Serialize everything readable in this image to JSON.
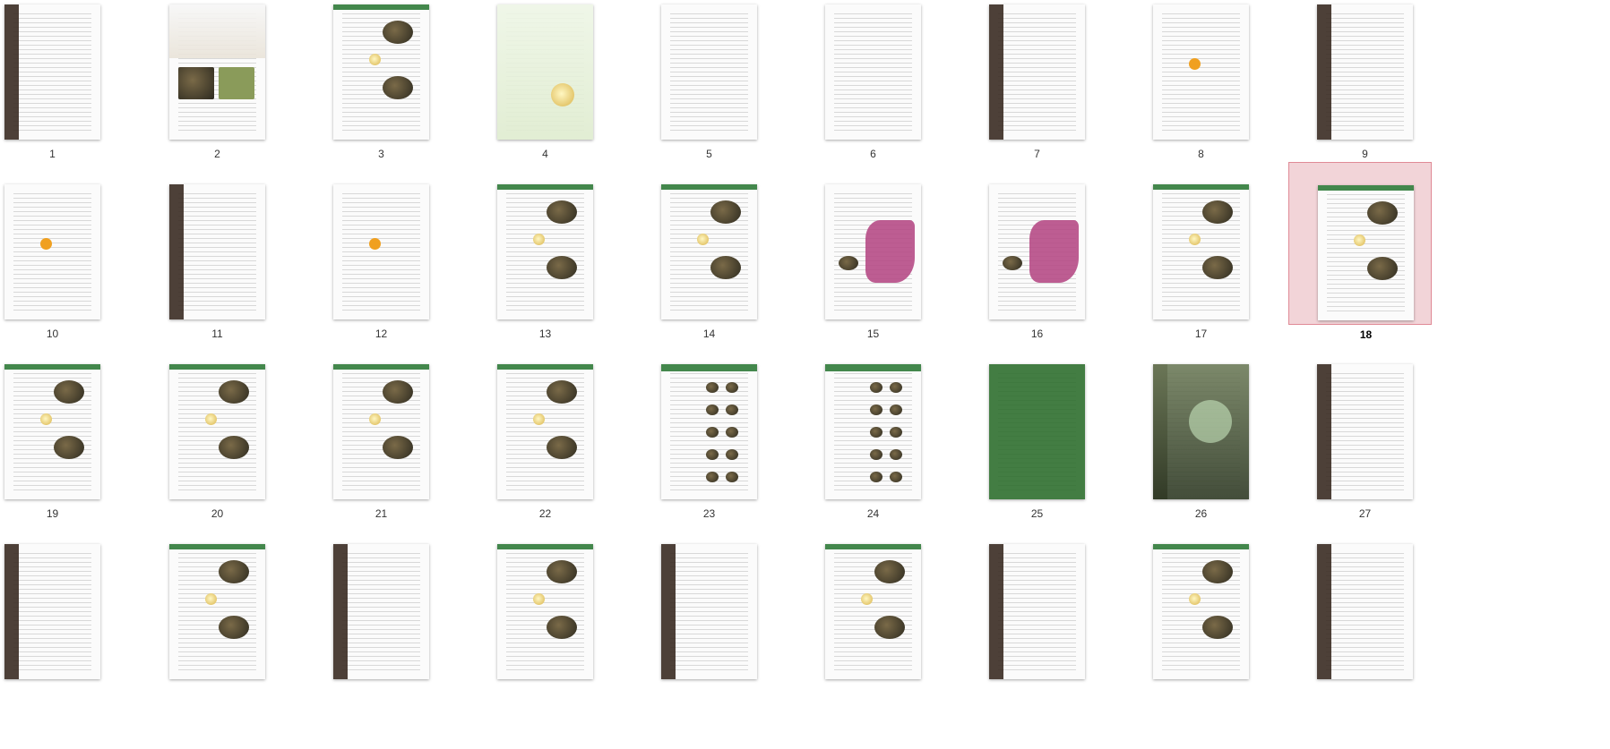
{
  "pages": [
    {
      "number": "1",
      "theme": "text-dark"
    },
    {
      "number": "2",
      "theme": "cover-collage"
    },
    {
      "number": "3",
      "theme": "text-leaves"
    },
    {
      "number": "4",
      "theme": "cover-green"
    },
    {
      "number": "5",
      "theme": "text"
    },
    {
      "number": "6",
      "theme": "text"
    },
    {
      "number": "7",
      "theme": "toc-photo"
    },
    {
      "number": "8",
      "theme": "toc"
    },
    {
      "number": "9",
      "theme": "toc-photo"
    },
    {
      "number": "10",
      "theme": "toc"
    },
    {
      "number": "11",
      "theme": "toc-photo"
    },
    {
      "number": "12",
      "theme": "toc"
    },
    {
      "number": "13",
      "theme": "tea-green"
    },
    {
      "number": "14",
      "theme": "tea-green"
    },
    {
      "number": "15",
      "theme": "map-pink"
    },
    {
      "number": "16",
      "theme": "map-pink"
    },
    {
      "number": "17",
      "theme": "tea-list"
    },
    {
      "number": "18",
      "theme": "tea-list",
      "selected": true
    },
    {
      "number": "19",
      "theme": "tea-list"
    },
    {
      "number": "20",
      "theme": "tea-list"
    },
    {
      "number": "21",
      "theme": "tea-list"
    },
    {
      "number": "22",
      "theme": "tea-list"
    },
    {
      "number": "23",
      "theme": "table-green"
    },
    {
      "number": "24",
      "theme": "table-green"
    },
    {
      "number": "25",
      "theme": "full-green"
    },
    {
      "number": "26",
      "theme": "photo-circle"
    },
    {
      "number": "27",
      "theme": "text-photo"
    },
    {
      "number": "",
      "theme": "text-photo"
    },
    {
      "number": "",
      "theme": "tea-list"
    },
    {
      "number": "",
      "theme": "text-photo"
    },
    {
      "number": "",
      "theme": "tea-list"
    },
    {
      "number": "",
      "theme": "text-photo"
    },
    {
      "number": "",
      "theme": "tea-list"
    },
    {
      "number": "",
      "theme": "text-photo"
    },
    {
      "number": "",
      "theme": "tea-list"
    },
    {
      "number": "",
      "theme": "text-photo"
    }
  ],
  "colors": {
    "selected_bg": "#f2d4d8",
    "selected_border": "#e08a96",
    "green": "#2f7a38",
    "pink": "#b64b86"
  }
}
